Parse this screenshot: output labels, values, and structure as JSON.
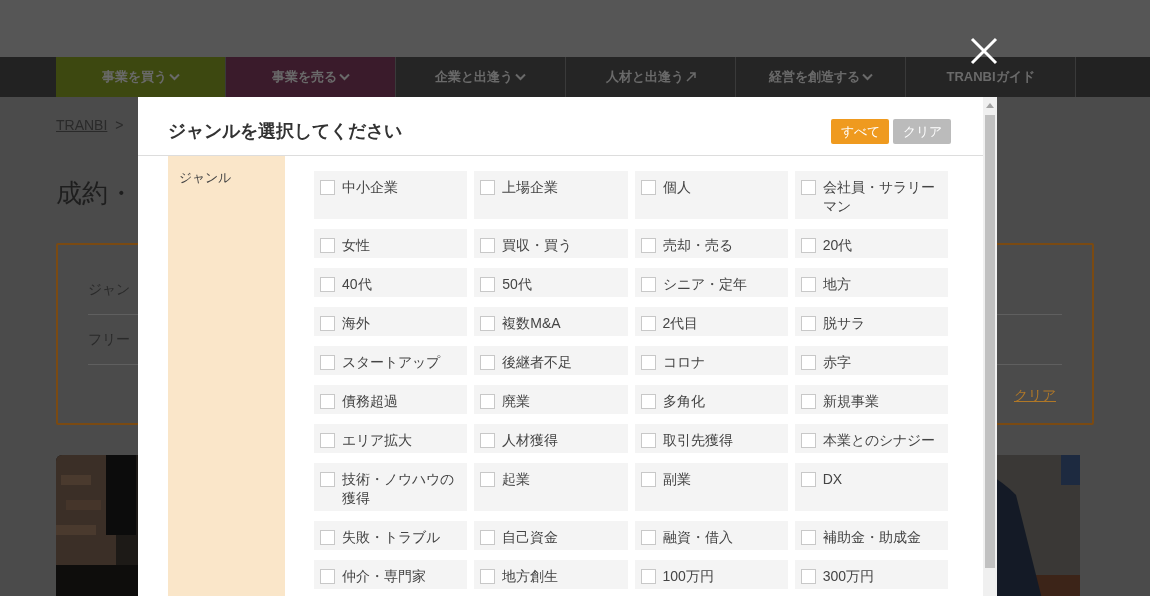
{
  "page": {
    "nav": [
      {
        "label": "事業を買う",
        "kind": "dropdown",
        "color": "#3d4810"
      },
      {
        "label": "事業を売る",
        "kind": "dropdown",
        "color": "#3a1b2b"
      },
      {
        "label": "企業と出逢う",
        "kind": "dropdown",
        "color": "#252525"
      },
      {
        "label": "人材と出逢う",
        "kind": "link",
        "color": "#252525"
      },
      {
        "label": "経営を創造する",
        "kind": "dropdown",
        "color": "#252525"
      },
      {
        "label": "TRANBIガイド",
        "kind": "plain",
        "color": "#252525"
      }
    ],
    "breadcrumb": {
      "home": "TRANBI",
      "separator": ">"
    },
    "title": "成約・",
    "search_box": {
      "genre_label": "ジャン",
      "freeword_label": "フリー",
      "clear_link": "クリア"
    }
  },
  "modal": {
    "title": "ジャンルを選択してください",
    "buttons": [
      {
        "label": "すべて",
        "kind": "primary"
      },
      {
        "label": "クリア",
        "kind": "secondary"
      }
    ],
    "label": "ジャンル",
    "options": [
      {
        "label": "中小企業",
        "checked": false
      },
      {
        "label": "上場企業",
        "checked": false
      },
      {
        "label": "個人",
        "checked": false
      },
      {
        "label": "会社員・サラリーマン",
        "checked": false
      },
      {
        "label": "女性",
        "checked": false
      },
      {
        "label": "買収・買う",
        "checked": false
      },
      {
        "label": "売却・売る",
        "checked": false
      },
      {
        "label": "20代",
        "checked": false
      },
      {
        "label": "40代",
        "checked": false
      },
      {
        "label": "50代",
        "checked": false
      },
      {
        "label": "シニア・定年",
        "checked": false
      },
      {
        "label": "地方",
        "checked": false
      },
      {
        "label": "海外",
        "checked": false
      },
      {
        "label": "複数M&A",
        "checked": false
      },
      {
        "label": "2代目",
        "checked": false
      },
      {
        "label": "脱サラ",
        "checked": false
      },
      {
        "label": "スタートアップ",
        "checked": false
      },
      {
        "label": "後継者不足",
        "checked": false
      },
      {
        "label": "コロナ",
        "checked": false
      },
      {
        "label": "赤字",
        "checked": false
      },
      {
        "label": "債務超過",
        "checked": false
      },
      {
        "label": "廃業",
        "checked": false
      },
      {
        "label": "多角化",
        "checked": false
      },
      {
        "label": "新規事業",
        "checked": false
      },
      {
        "label": "エリア拡大",
        "checked": false
      },
      {
        "label": "人材獲得",
        "checked": false
      },
      {
        "label": "取引先獲得",
        "checked": false
      },
      {
        "label": "本業とのシナジー",
        "checked": false
      },
      {
        "label": "技術・ノウハウの獲得",
        "checked": false
      },
      {
        "label": "起業",
        "checked": false
      },
      {
        "label": "副業",
        "checked": false
      },
      {
        "label": "DX",
        "checked": false
      },
      {
        "label": "失敗・トラブル",
        "checked": false
      },
      {
        "label": "自己資金",
        "checked": false
      },
      {
        "label": "融資・借入",
        "checked": false
      },
      {
        "label": "補助金・助成金",
        "checked": false
      },
      {
        "label": "仲介・専門家",
        "checked": false
      },
      {
        "label": "地方創生",
        "checked": false
      },
      {
        "label": "100万円",
        "checked": false
      },
      {
        "label": "300万円",
        "checked": false
      }
    ]
  }
}
